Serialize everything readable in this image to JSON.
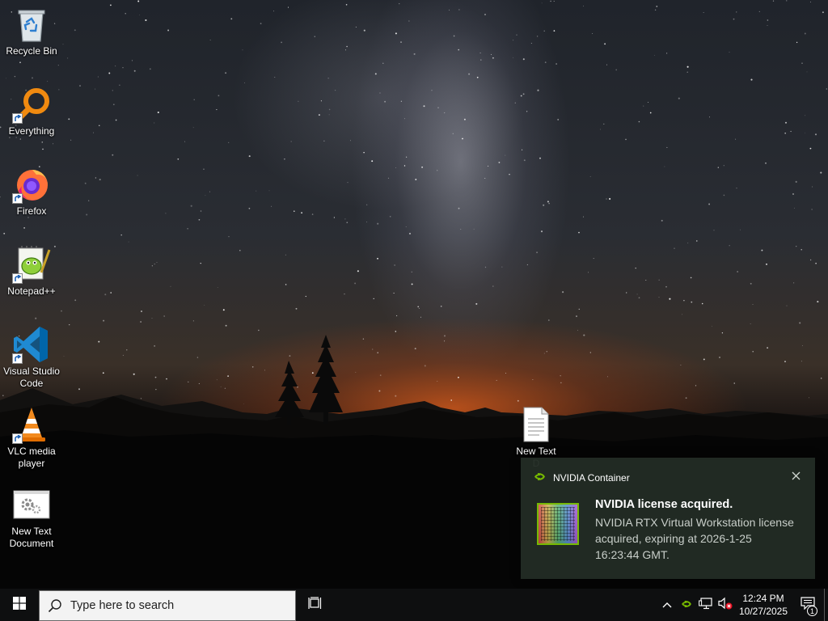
{
  "desktop": {
    "icons": [
      {
        "label": "Recycle Bin",
        "icon": "recycle-bin-icon"
      },
      {
        "label": "Everything",
        "icon": "everything-search-icon"
      },
      {
        "label": "Firefox",
        "icon": "firefox-icon"
      },
      {
        "label": "Notepad++",
        "icon": "notepad-plus-plus-icon"
      },
      {
        "label": "Visual Studio\nCode",
        "icon": "vscode-icon"
      },
      {
        "label": "VLC media\nplayer",
        "icon": "vlc-icon"
      },
      {
        "label": "New Text\nDocument",
        "icon": "settings-document-icon"
      },
      {
        "label": "New Text\nD",
        "icon": "text-document-icon"
      }
    ]
  },
  "notification": {
    "app_name": "NVIDIA Container",
    "title": "NVIDIA license acquired.",
    "body": "NVIDIA RTX Virtual Workstation license acquired, expiring at 2026-1-25 16:23:44 GMT.",
    "accent_color": "#76b900"
  },
  "taskbar": {
    "search_placeholder": "Type here to search",
    "time": "12:24 PM",
    "date": "10/27/2025",
    "notification_count": "1"
  }
}
